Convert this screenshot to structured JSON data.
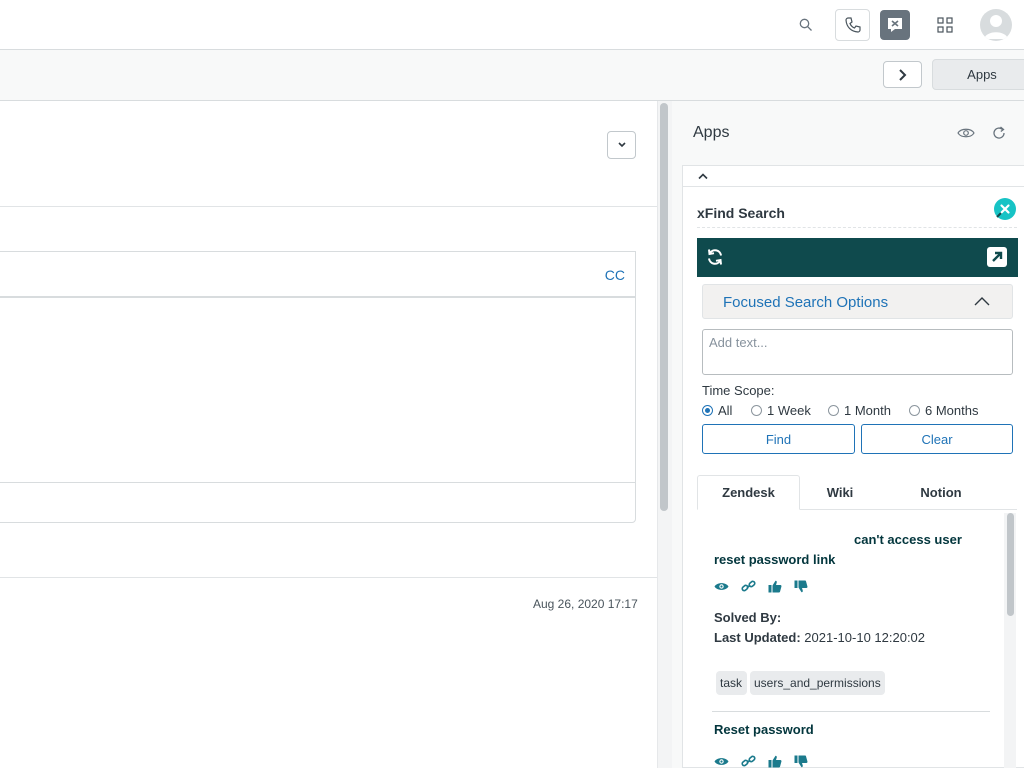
{
  "subbar": {
    "apps_button_label": "Apps"
  },
  "ticket": {
    "cc_label": "CC",
    "timestamp": "Aug 26, 2020 17:17"
  },
  "apps_panel": {
    "title": "Apps",
    "app": {
      "name": "xFind Search",
      "focused_search_label": "Focused Search Options",
      "search_placeholder": "Add text...",
      "time_scope_label": "Time Scope:",
      "time_scope_options": [
        "All",
        "1 Week",
        "1 Month",
        "6 Months"
      ],
      "time_scope_selected": "All",
      "find_label": "Find",
      "clear_label": "Clear",
      "tabs": [
        "Zendesk",
        "Wiki",
        "Notion"
      ],
      "active_tab": "Zendesk",
      "results": [
        {
          "title_line1": "can't access user",
          "title_line2": "reset password link",
          "solved_by_label": "Solved By:",
          "last_updated_label": "Last Updated:",
          "last_updated_value": "2021-10-10 12:20:02",
          "tags": [
            "task",
            "users_and_permissions"
          ]
        },
        {
          "title_line1": "Reset password"
        }
      ]
    }
  },
  "colors": {
    "accent": "#1f73b7",
    "toolbar": "#0f4a4d",
    "xfind_logo": "#17c3c5",
    "result_icon": "#1b7a8c"
  },
  "icons": [
    "search-icon",
    "phone-icon",
    "xfind-icon",
    "grid-icon",
    "avatar-icon",
    "chevron-right-icon",
    "chevron-down-icon",
    "eye-icon",
    "refresh-icon",
    "chevron-up-icon",
    "sync-icon",
    "external-link-icon",
    "link-icon",
    "thumbs-up-icon",
    "thumbs-down-icon"
  ]
}
